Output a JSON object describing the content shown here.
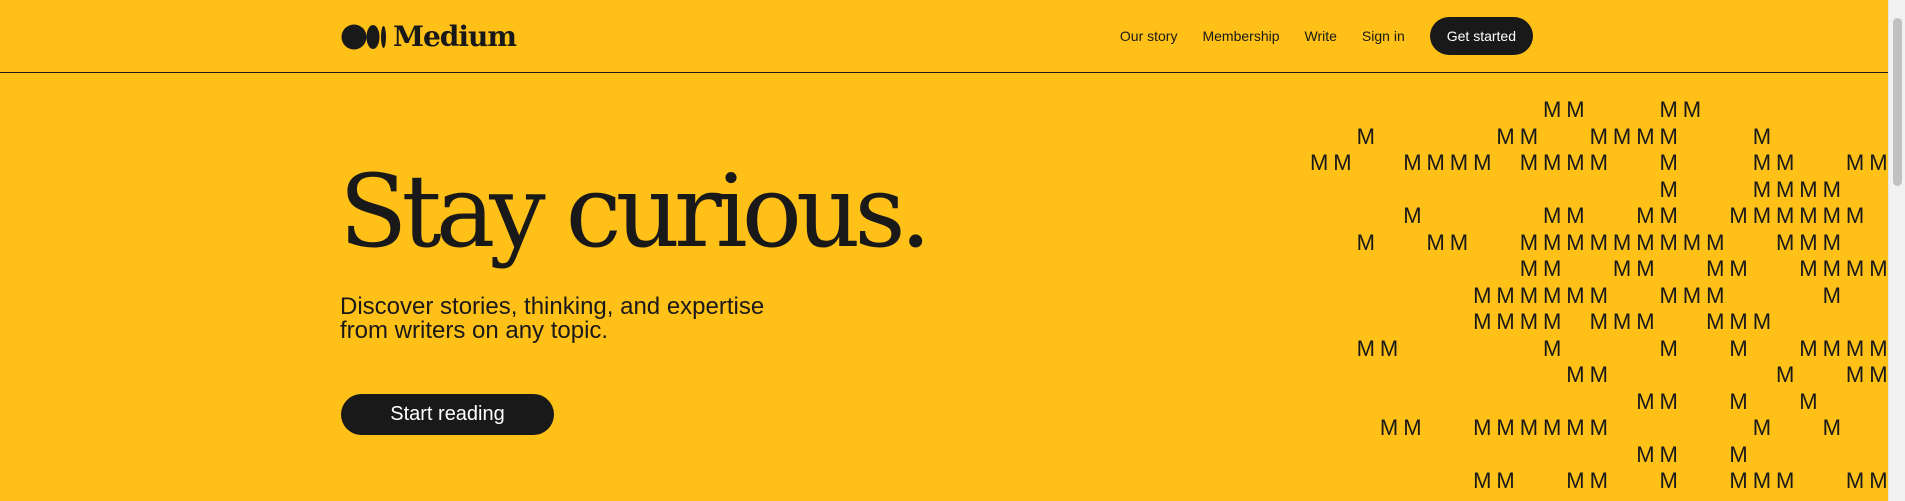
{
  "header": {
    "logo_text": "Medium",
    "nav": [
      "Our story",
      "Membership",
      "Write",
      "Sign in"
    ],
    "cta": "Get started"
  },
  "hero": {
    "title": "Stay curious.",
    "subtitle": "Discover stories, thinking, and expertise from writers on any topic.",
    "button": "Start reading"
  },
  "pattern": {
    "glyph": "M",
    "rows": [
      "..........MM...MM",
      "..M.....MM..MMMM...M",
      "MM..MMMM.MMMM..M...MM..MM",
      "...............M...MMMM...MM",
      "....M.....MM..MM..MMMMMM.M",
      "..M..MM..MMMMMMMMM..MMM..MM",
      ".........MM..MM..MM..MMMM",
      ".......MMMMMM..MMM....M",
      ".......MMMM.MMM..MMM",
      "..MM......M....M..M..MMMM",
      "...........MM.......M..MMM",
      "..............MM..M..M...MM",
      "...MM..MMMMMM......M..M...MM",
      "..............MM..M",
      ".......MM..MM..M..MMM..MM"
    ]
  },
  "colors": {
    "background": "#FFC017",
    "ink": "#191919"
  }
}
